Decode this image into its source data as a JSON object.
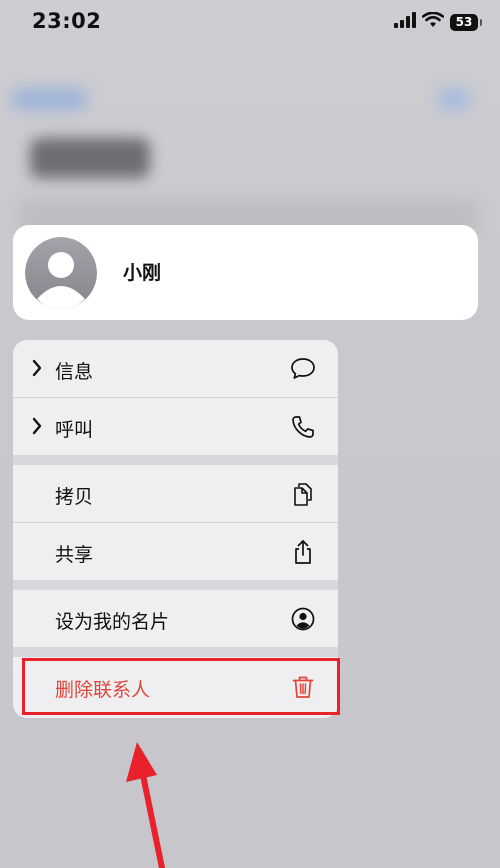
{
  "status_bar": {
    "time": "23:02",
    "battery": "53"
  },
  "contact": {
    "name": "小刚"
  },
  "menu": {
    "items": [
      {
        "label": "信息",
        "icon": "message-bubble-icon",
        "has_chevron": true
      },
      {
        "label": "呼叫",
        "icon": "phone-icon",
        "has_chevron": true
      },
      {
        "label": "拷贝",
        "icon": "copy-icon",
        "has_chevron": false
      },
      {
        "label": "共享",
        "icon": "share-icon",
        "has_chevron": false
      },
      {
        "label": "设为我的名片",
        "icon": "person-circle-icon",
        "has_chevron": false
      },
      {
        "label": "删除联系人",
        "icon": "trash-icon",
        "has_chevron": false,
        "destructive": true
      }
    ]
  },
  "colors": {
    "destructive": "#e0463a",
    "annotation": "#e8212a",
    "menu_bg": "#efeff2",
    "backdrop": "#c9c9ce"
  }
}
